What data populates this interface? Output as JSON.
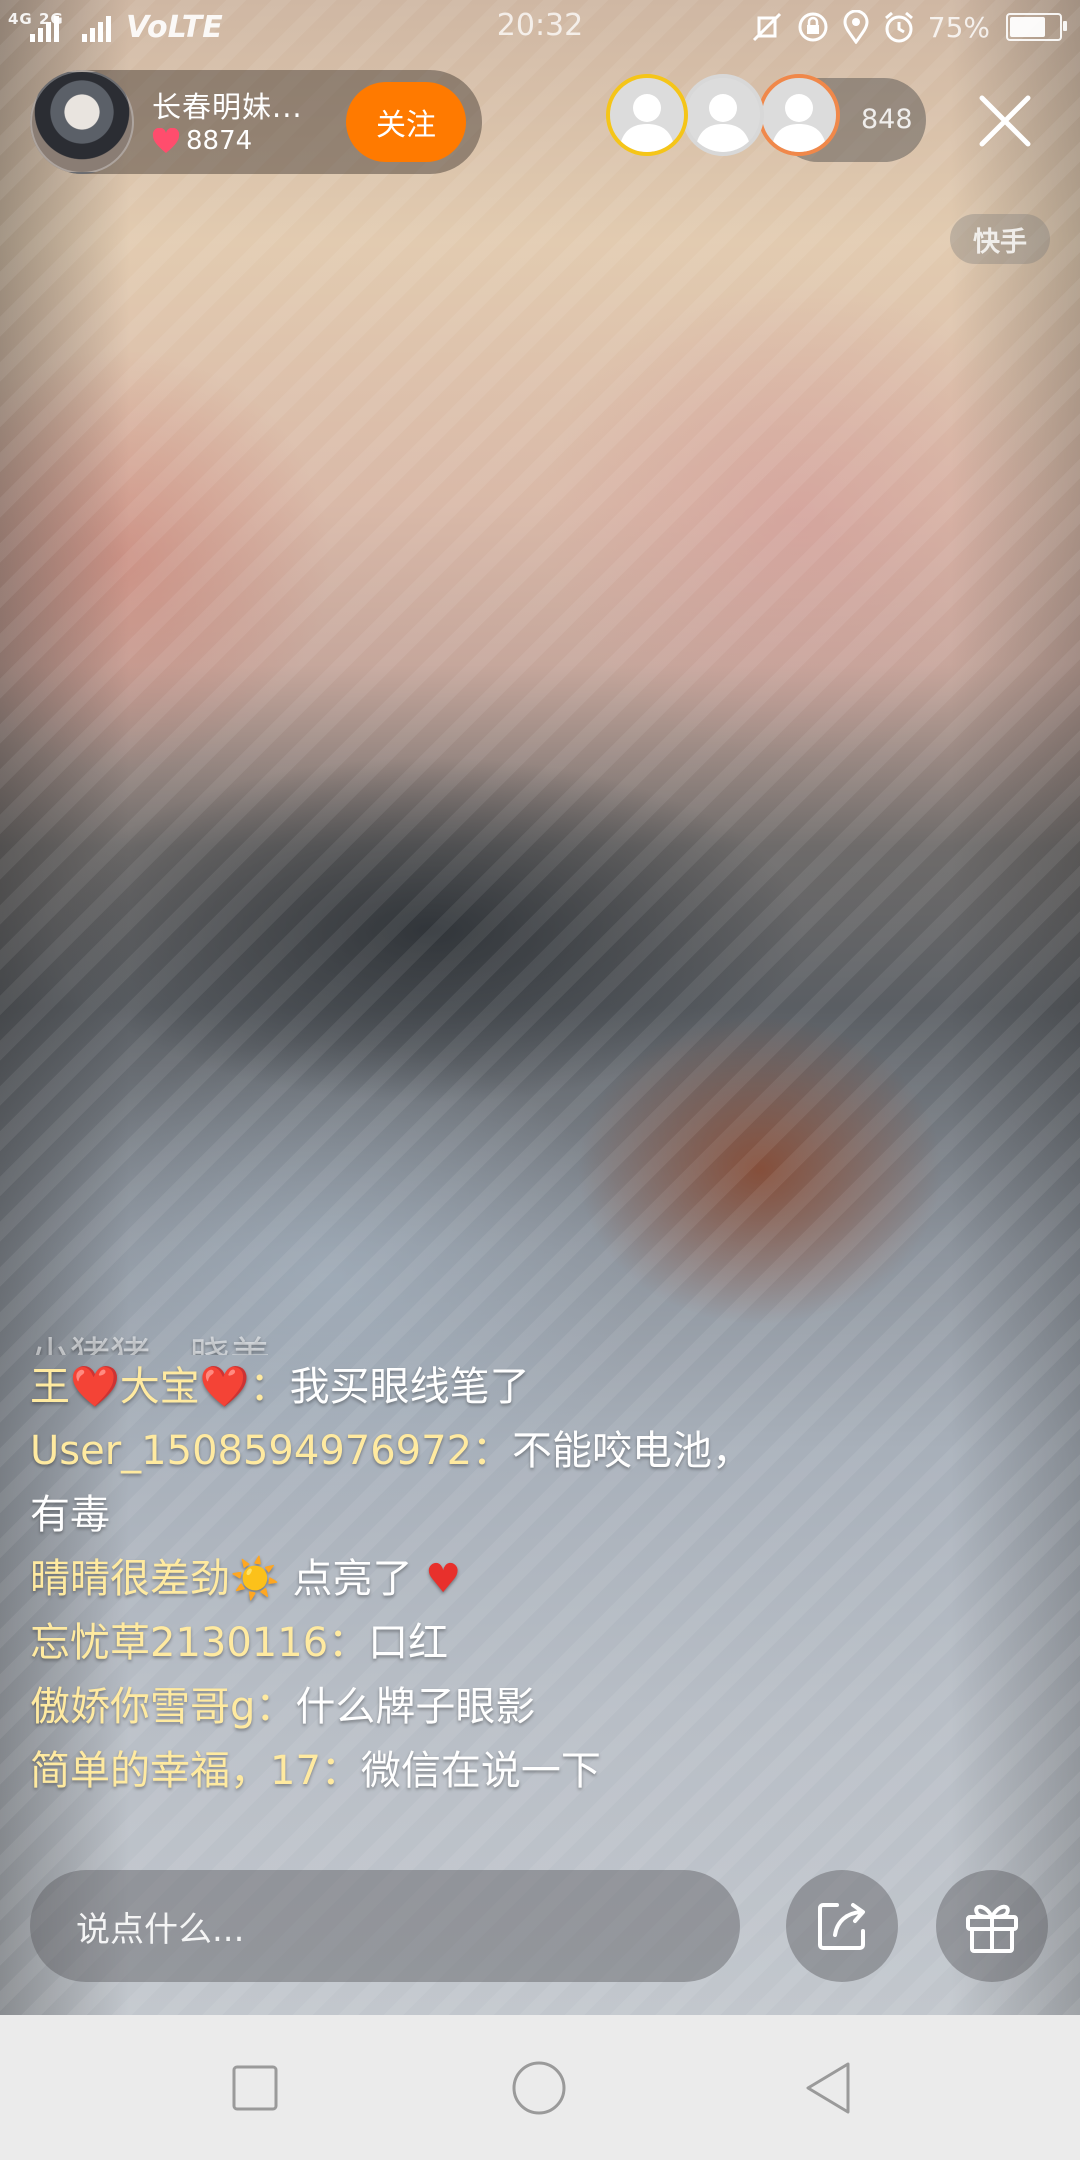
{
  "status_bar": {
    "network": "4G 2G",
    "volte": "VoLTE",
    "time": "20:32",
    "battery": "75%",
    "battery_level": 0.75
  },
  "streamer": {
    "name": "长春明妹...",
    "likes": "8874",
    "follow_label": "关注"
  },
  "viewers": {
    "count": "848",
    "avatar_ring_colors": [
      "#f5c518",
      "#d8d8d8",
      "#f0884a"
    ]
  },
  "watermark": "快手",
  "chat": {
    "partial_line": "小猪猪、晓美",
    "messages": [
      {
        "user": "王❤️大宝❤️：",
        "text": "我买眼线笔了"
      },
      {
        "user": "User_1508594976972：",
        "text": "不能咬电池，有毒"
      },
      {
        "user": "晴晴很差劲☀️",
        "text": " 点亮了 ",
        "heart": "♥"
      },
      {
        "user": "忘忧草2130116：",
        "text": "口红"
      },
      {
        "user": "傲娇你雪哥g：",
        "text": "什么牌子眼影"
      },
      {
        "user": "简单的幸福，17：",
        "text": "微信在说一下"
      }
    ]
  },
  "input": {
    "placeholder": "说点什么..."
  },
  "icons": {
    "share": "share-icon",
    "gift": "gift-icon",
    "close": "close-icon",
    "nav_recent": "square-icon",
    "nav_home": "circle-icon",
    "nav_back": "triangle-back-icon"
  },
  "colors": {
    "follow_button": "#ff7a00",
    "username": "#ffeaa0",
    "heart": "#e8302c"
  }
}
